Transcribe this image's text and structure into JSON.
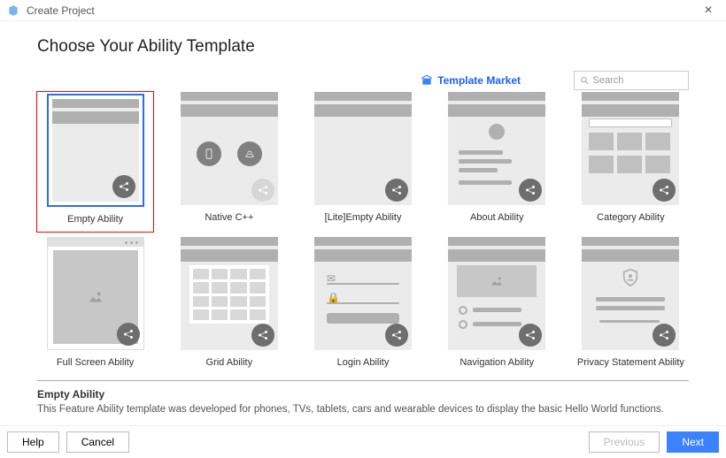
{
  "window": {
    "title": "Create Project"
  },
  "heading": "Choose Your Ability Template",
  "template_market_label": "Template Market",
  "search": {
    "placeholder": "Search"
  },
  "templates": [
    {
      "label": "Empty Ability"
    },
    {
      "label": "Native C++"
    },
    {
      "label": "[Lite]Empty Ability"
    },
    {
      "label": "About Ability"
    },
    {
      "label": "Category Ability"
    },
    {
      "label": "Full Screen Ability"
    },
    {
      "label": "Grid Ability"
    },
    {
      "label": "Login Ability"
    },
    {
      "label": "Navigation Ability"
    },
    {
      "label": "Privacy Statement Ability"
    }
  ],
  "selected": {
    "title": "Empty Ability",
    "description": "This Feature Ability template was developed for phones, TVs, tablets, cars and wearable devices to display the basic Hello World functions."
  },
  "footer": {
    "help": "Help",
    "cancel": "Cancel",
    "previous": "Previous",
    "next": "Next"
  }
}
